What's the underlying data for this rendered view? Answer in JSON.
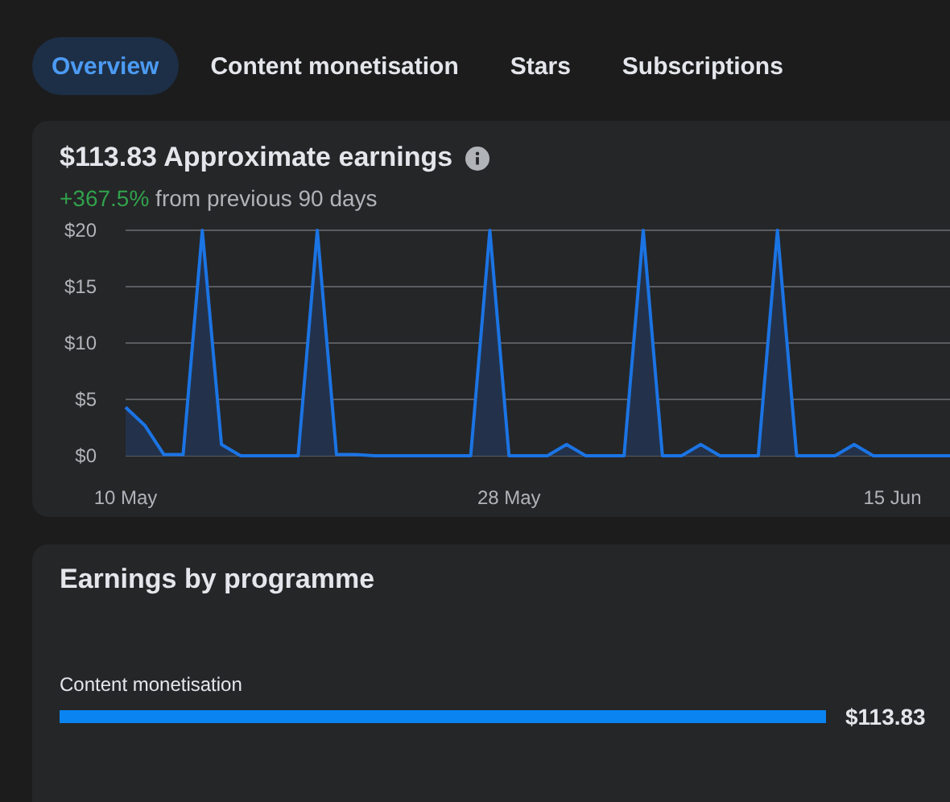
{
  "tabs": [
    {
      "label": "Overview",
      "selected": true
    },
    {
      "label": "Content monetisation",
      "selected": false
    },
    {
      "label": "Stars",
      "selected": false
    },
    {
      "label": "Subscriptions",
      "selected": false
    }
  ],
  "earnings": {
    "amount": "$113.83",
    "title": "Approximate earnings",
    "change": "+367.5%",
    "change_note": "from previous 90 days",
    "chart_data": {
      "type": "area",
      "categories": [
        "10 May",
        null,
        null,
        null,
        null,
        null,
        null,
        null,
        null,
        null,
        null,
        null,
        null,
        null,
        null,
        null,
        null,
        null,
        null,
        null,
        "28 May",
        null,
        null,
        null,
        null,
        null,
        null,
        null,
        null,
        null,
        null,
        null,
        null,
        null,
        null,
        null,
        null,
        null,
        null,
        null,
        "15 Jun",
        null,
        null,
        null
      ],
      "series": [
        {
          "color": "#1b74e4",
          "values": [
            4.3,
            2.7,
            0.1,
            0.1,
            20,
            1,
            0,
            0,
            0,
            0,
            20,
            0.1,
            0.1,
            0,
            0,
            0,
            0,
            0,
            0,
            20,
            0,
            0,
            0,
            1,
            0,
            0,
            0,
            20,
            0,
            0,
            1,
            0,
            0,
            0,
            20,
            0,
            0,
            0,
            1,
            0,
            0,
            0,
            0,
            0
          ]
        }
      ],
      "ylim": [
        0,
        20
      ],
      "grid": true,
      "yticks": [
        {
          "value": 0,
          "label": "$0"
        },
        {
          "value": 5,
          "label": "$5"
        },
        {
          "value": 10,
          "label": "$10"
        },
        {
          "value": 15,
          "label": "$15"
        },
        {
          "value": 20,
          "label": "$20"
        }
      ]
    }
  },
  "programmes": {
    "title": "Earnings by programme",
    "items": [
      {
        "name": "Content monetisation",
        "amount": "$113.83"
      }
    ]
  }
}
